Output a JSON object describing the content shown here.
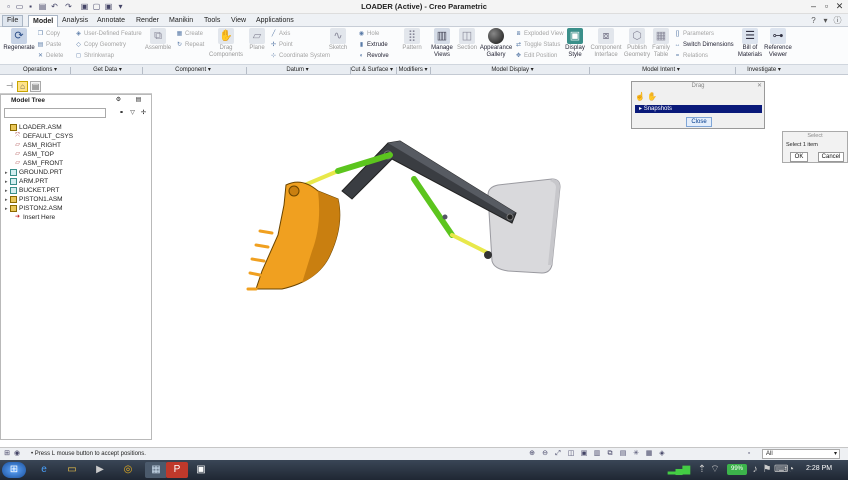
{
  "window": {
    "title": "LOADER (Active) - Creo Parametric",
    "quick_access_icons": [
      "new-icon",
      "open-icon",
      "save-icon",
      "undo-icon",
      "redo-icon",
      "regenerate-icon",
      "close-window-icon"
    ]
  },
  "menu": {
    "tabs": [
      "File",
      "Model",
      "Analysis",
      "Annotate",
      "Render",
      "Manikin",
      "Tools",
      "View",
      "Applications"
    ],
    "active": "Model"
  },
  "ribbon": {
    "regenerate": "Regenerate",
    "copy": "Copy",
    "paste": "Paste",
    "delete": "Delete",
    "user_defined_feature": "User-Defined Feature",
    "copy_geometry": "Copy Geometry",
    "shrinkwrap": "Shrinkwrap",
    "assemble": "Assemble",
    "create": "Create",
    "repeat": "Repeat",
    "drag_components": "Drag Components",
    "plane": "Plane",
    "axis": "Axis",
    "point": "Point",
    "coordinate_system": "Coordinate System",
    "sketch": "Sketch",
    "hole": "Hole",
    "extrude": "Extrude",
    "revolve": "Revolve",
    "pattern": "Pattern",
    "manage_views": "Manage Views",
    "section": "Section",
    "appearance_gallery": "Appearance Gallery",
    "exploded_view": "Exploded View",
    "toggle_status": "Toggle Status",
    "edit_position": "Edit Position",
    "display_style": "Display Style",
    "component_interface": "Component Interface",
    "publish_geometry": "Publish Geometry",
    "family_table": "Family Table",
    "parameters": "Parameters",
    "switch_dimensions": "Switch Dimensions",
    "relations": "Relations",
    "bill_of_materials": "Bill of Materials",
    "reference_viewer": "Reference Viewer"
  },
  "groups": [
    "Operations ▾",
    "Get Data ▾",
    "Component ▾",
    "Datum ▾",
    "Cut & Surface ▾",
    "Modifiers ▾",
    "Model Display ▾",
    "Model Intent ▾",
    "Investigate ▾"
  ],
  "model_tree": {
    "header": "Model Tree",
    "items": [
      {
        "label": "LOADER.ASM",
        "icon": "assembly-icon",
        "expand": ""
      },
      {
        "label": "DEFAULT_CSYS",
        "icon": "csys-icon",
        "expand": ""
      },
      {
        "label": "ASM_RIGHT",
        "icon": "datum-plane-icon",
        "expand": ""
      },
      {
        "label": "ASM_TOP",
        "icon": "datum-plane-icon",
        "expand": ""
      },
      {
        "label": "ASM_FRONT",
        "icon": "datum-plane-icon",
        "expand": ""
      },
      {
        "label": "GROUND.PRT",
        "icon": "part-icon",
        "expand": "▸"
      },
      {
        "label": "ARM.PRT",
        "icon": "part-icon",
        "expand": "▸"
      },
      {
        "label": "BUCKET.PRT",
        "icon": "part-icon",
        "expand": "▸"
      },
      {
        "label": "PISTON1.ASM",
        "icon": "subassembly-icon",
        "expand": "▸"
      },
      {
        "label": "PISTON2.ASM",
        "icon": "subassembly-icon",
        "expand": "▸"
      },
      {
        "label": "Insert Here",
        "icon": "insert-arrow-icon",
        "expand": ""
      }
    ]
  },
  "drag_dialog": {
    "title": "Drag",
    "snapshots": "Snapshots",
    "close": "Close"
  },
  "select_dialog": {
    "title": "Select",
    "prompt": "Select 1 item",
    "ok": "OK",
    "cancel": "Cancel"
  },
  "status": {
    "message": "Press L mouse button to accept positions.",
    "filter": "All"
  },
  "taskbar": {
    "battery": "99%",
    "time": "2:28 PM"
  },
  "colors": {
    "accent": "#0a1a7a",
    "bucket": "#f0a020",
    "arm": "#3a3d42",
    "piston_rod": "#66cc22",
    "ground_plate": "#d9d9dc"
  }
}
